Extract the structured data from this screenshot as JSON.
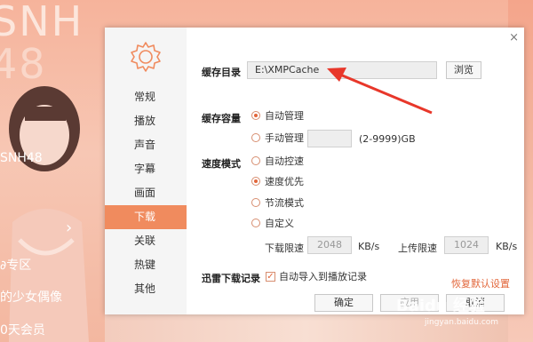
{
  "background": {
    "brand_text": "SNH",
    "brand_text_2": "48",
    "group_label": "SNH48",
    "lines": [
      "∂专区",
      "的少女偶像",
      "0天会员"
    ]
  },
  "dialog": {
    "close_glyph": "×",
    "nav": {
      "items": [
        {
          "label": "常规"
        },
        {
          "label": "播放"
        },
        {
          "label": "声音"
        },
        {
          "label": "字幕"
        },
        {
          "label": "画面"
        },
        {
          "label": "下载",
          "active": true
        },
        {
          "label": "关联"
        },
        {
          "label": "热键"
        },
        {
          "label": "其他"
        }
      ]
    },
    "cache_dir": {
      "label": "缓存目录",
      "value": "E:\\XMPCache",
      "browse_label": "浏览"
    },
    "cache_size": {
      "label": "缓存容量",
      "auto_label": "自动管理",
      "auto_checked": true,
      "manual_label": "手动管理",
      "manual_checked": false,
      "manual_value": "",
      "range_hint": "(2-9999)GB"
    },
    "speed_mode": {
      "label": "速度模式",
      "options": [
        {
          "label": "自动控速",
          "checked": false
        },
        {
          "label": "速度优先",
          "checked": true
        },
        {
          "label": "节流模式",
          "checked": false
        },
        {
          "label": "自定义",
          "checked": false
        }
      ],
      "download_limit_label": "下载限速",
      "download_limit_value": "2048",
      "download_unit": "KB/s",
      "upload_limit_label": "上传限速",
      "upload_limit_value": "1024",
      "upload_unit": "KB/s"
    },
    "thunder": {
      "label": "迅雷下载记录",
      "import_label": "自动导入到播放记录",
      "import_checked": true
    },
    "restore_label": "恢复默认设置",
    "ok_label": "确定",
    "apply_label": "应用",
    "cancel_label": "取消",
    "annotation_arrow_color": "#e8372a",
    "accent_color": "#f08b5e"
  },
  "watermark": {
    "text": "Baidu 经验",
    "sub": "jingyan.baidu.com"
  }
}
